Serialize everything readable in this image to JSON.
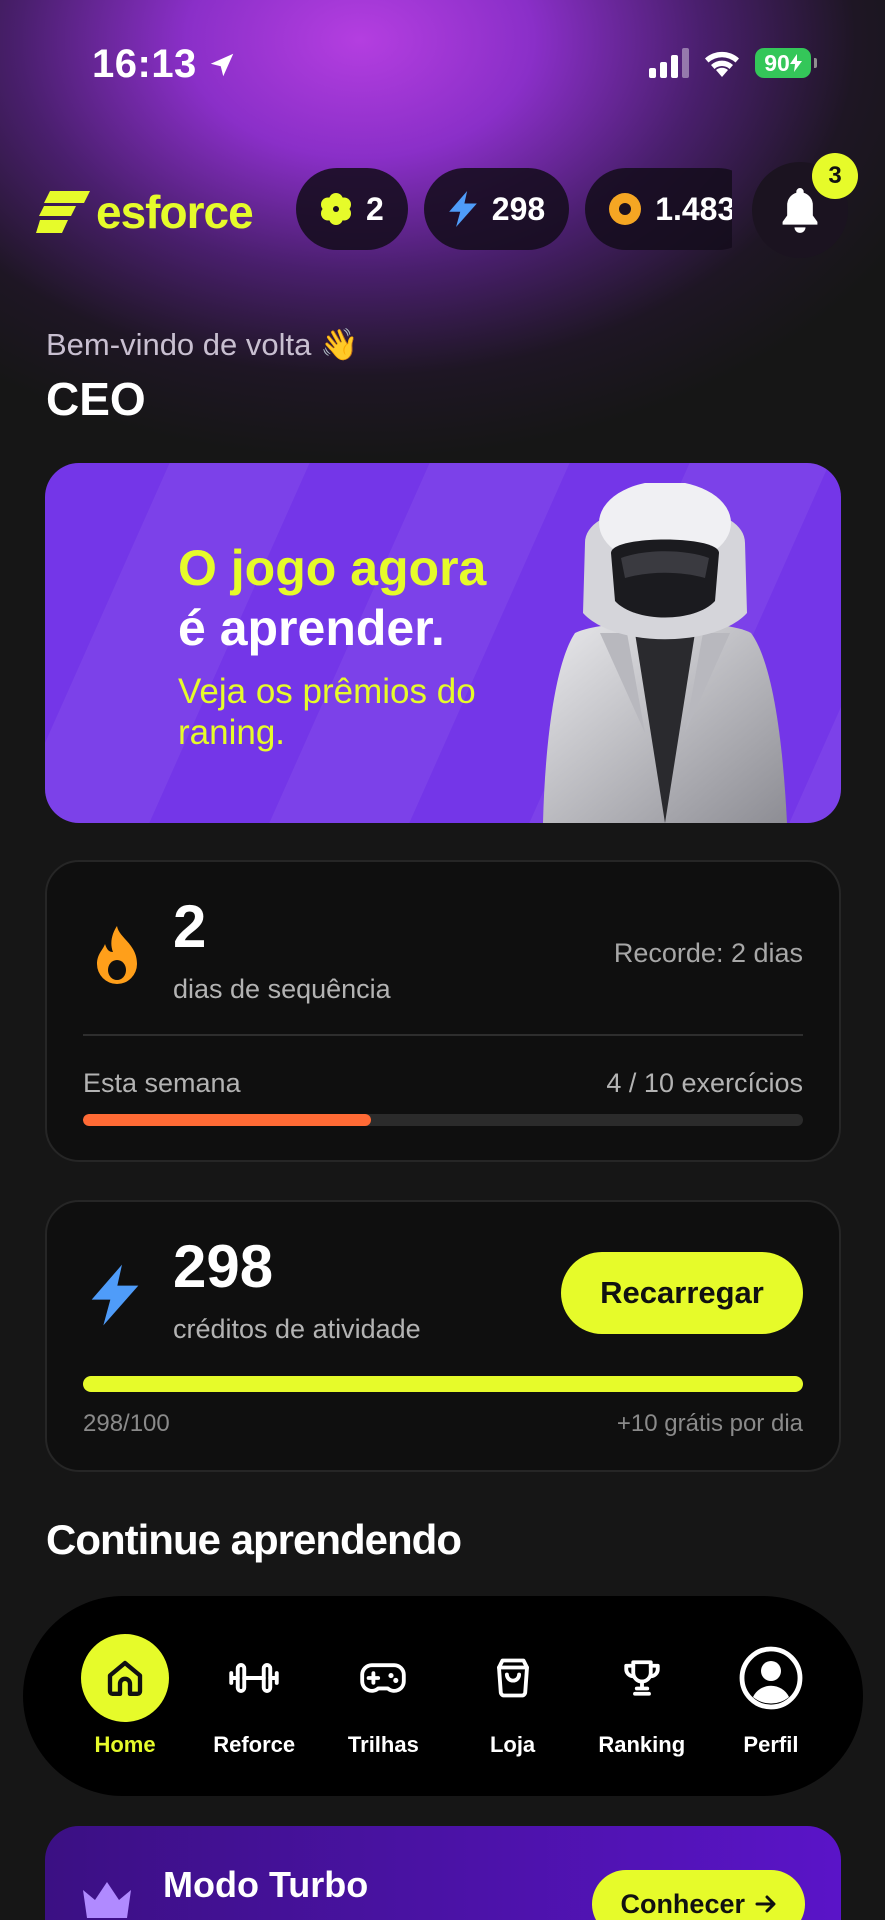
{
  "status_bar": {
    "time": "16:13",
    "battery": "90"
  },
  "header": {
    "logo_text": "esforce",
    "stats": [
      {
        "icon": "asterisk-icon",
        "value": "2",
        "color": "#e6fb2a"
      },
      {
        "icon": "lightning-icon",
        "value": "298",
        "color": "#4f9cf9"
      },
      {
        "icon": "coin-icon",
        "value": "1.483",
        "color": "#f5a623"
      }
    ],
    "notifications_count": "3"
  },
  "welcome": {
    "greeting": "Bem-vindo de volta 👋",
    "name": "CEO"
  },
  "banner": {
    "line1": "O jogo agora",
    "line2": "é aprender.",
    "subtitle": "Veja os prêmios do raning."
  },
  "streak_card": {
    "value": "2",
    "label": "dias de sequência",
    "record": "Recorde: 2 dias",
    "week_label": "Esta semana",
    "week_progress_text": "4 / 10 exercícios",
    "week_progress_fraction": 0.4,
    "accent": "#ff6a35"
  },
  "credits_card": {
    "value": "298",
    "label": "créditos de atividade",
    "button_label": "Recarregar",
    "progress_text": "298/100",
    "daily_bonus": "+10 grátis por dia",
    "progress_fraction": 1.0,
    "accent": "#e6fb2a"
  },
  "section_title": "Continue aprendendo",
  "turbo_card": {
    "title": "Modo Turbo",
    "button_label": "Conhecer"
  },
  "tabbar": {
    "items": [
      {
        "label": "Home",
        "icon": "home-icon",
        "active": true
      },
      {
        "label": "Reforce",
        "icon": "dumbbell-icon",
        "active": false
      },
      {
        "label": "Trilhas",
        "icon": "gamepad-icon",
        "active": false
      },
      {
        "label": "Loja",
        "icon": "shopping-bag-icon",
        "active": false
      },
      {
        "label": "Ranking",
        "icon": "trophy-icon",
        "active": false
      },
      {
        "label": "Perfil",
        "icon": "profile-icon",
        "active": false
      }
    ]
  }
}
